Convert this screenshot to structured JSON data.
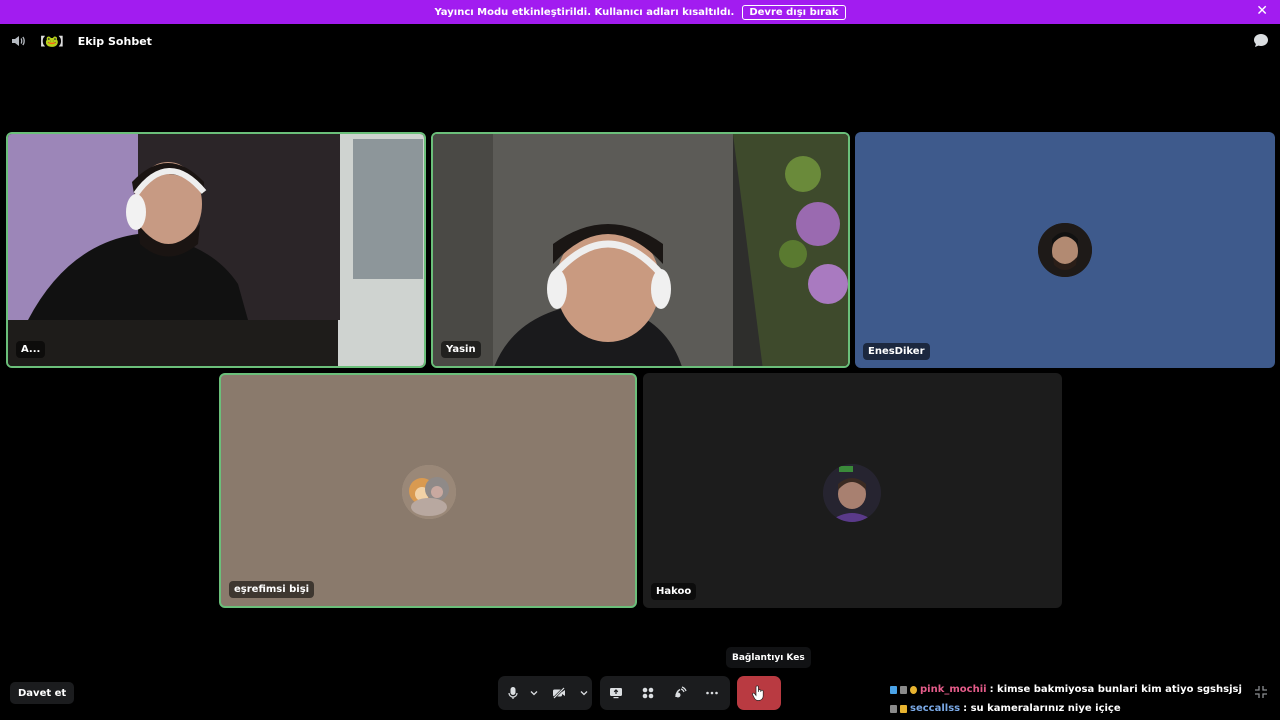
{
  "banner": {
    "message": "Yayıncı Modu etkinleştirildi. Kullanıcı adları kısaltıldı.",
    "button_label": "Devre dışı bırak",
    "close_glyph": "✕"
  },
  "header": {
    "channel_prefix": "【🐸】",
    "channel_name": "Ekip Sohbet"
  },
  "tiles": [
    {
      "name": "A...",
      "speaking": true,
      "camera": true
    },
    {
      "name": "Yasin",
      "speaking": true,
      "camera": true
    },
    {
      "name": "EnesDiker",
      "speaking": false,
      "camera": false,
      "bg": "#3e5a8c"
    },
    {
      "name": "eşrefimsi bişi",
      "speaking": true,
      "camera": false,
      "bg": "#8a7a6c"
    },
    {
      "name": "Hakoo",
      "speaking": false,
      "camera": false,
      "bg": "#1c1c1c"
    }
  ],
  "controls": {
    "invite_label": "Davet et",
    "tooltip_label": "Bağlantıyı Kes",
    "icons": [
      "microphone-icon",
      "chevron-down-icon",
      "camera-off-icon",
      "chevron-down-icon",
      "screen-share-icon",
      "activities-icon",
      "soundboard-icon",
      "more-icon",
      "disconnect-icon"
    ]
  },
  "chat": [
    {
      "user": "pink_mochii",
      "message": ": kimse bakmiyosa bunlari kim atiyo sgshsjsj",
      "user_color": "#e55c8a"
    },
    {
      "user": "seccallss",
      "message": ": su kameralarınız niye içiçe",
      "user_color": "#7aa9e6"
    }
  ],
  "colors": {
    "banner": "#a21cf0",
    "speaking_border": "#6bbf7a",
    "hangup": "#b93a41"
  }
}
